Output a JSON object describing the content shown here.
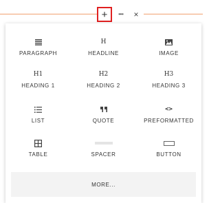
{
  "toolbar": {
    "add_icon": "+",
    "more_icon": "•••",
    "close_icon": "×"
  },
  "blocks": {
    "paragraph": {
      "label": "PARAGRAPH",
      "icon": "paragraph-icon"
    },
    "headline": {
      "label": "HEADLINE",
      "icon_text": "H"
    },
    "image": {
      "label": "IMAGE",
      "icon": "image-icon"
    },
    "heading1": {
      "label": "HEADING 1",
      "icon_text": "H1"
    },
    "heading2": {
      "label": "HEADING 2",
      "icon_text": "H2"
    },
    "heading3": {
      "label": "HEADING 3",
      "icon_text": "H3"
    },
    "list": {
      "label": "LIST",
      "icon": "list-icon"
    },
    "quote": {
      "label": "QUOTE",
      "icon": "quote-icon"
    },
    "preformatted": {
      "label": "PREFORMATTED",
      "icon_text": "<>"
    },
    "table": {
      "label": "TABLE",
      "icon": "table-icon"
    },
    "spacer": {
      "label": "SPACER",
      "icon": "spacer-icon"
    },
    "button": {
      "label": "BUTTON",
      "icon": "button-icon"
    }
  },
  "more_label": "MORE...",
  "colors": {
    "accent_line": "#f0a070",
    "highlight_border": "#e02020",
    "text": "#333333",
    "more_bg": "#f3f3f3"
  }
}
